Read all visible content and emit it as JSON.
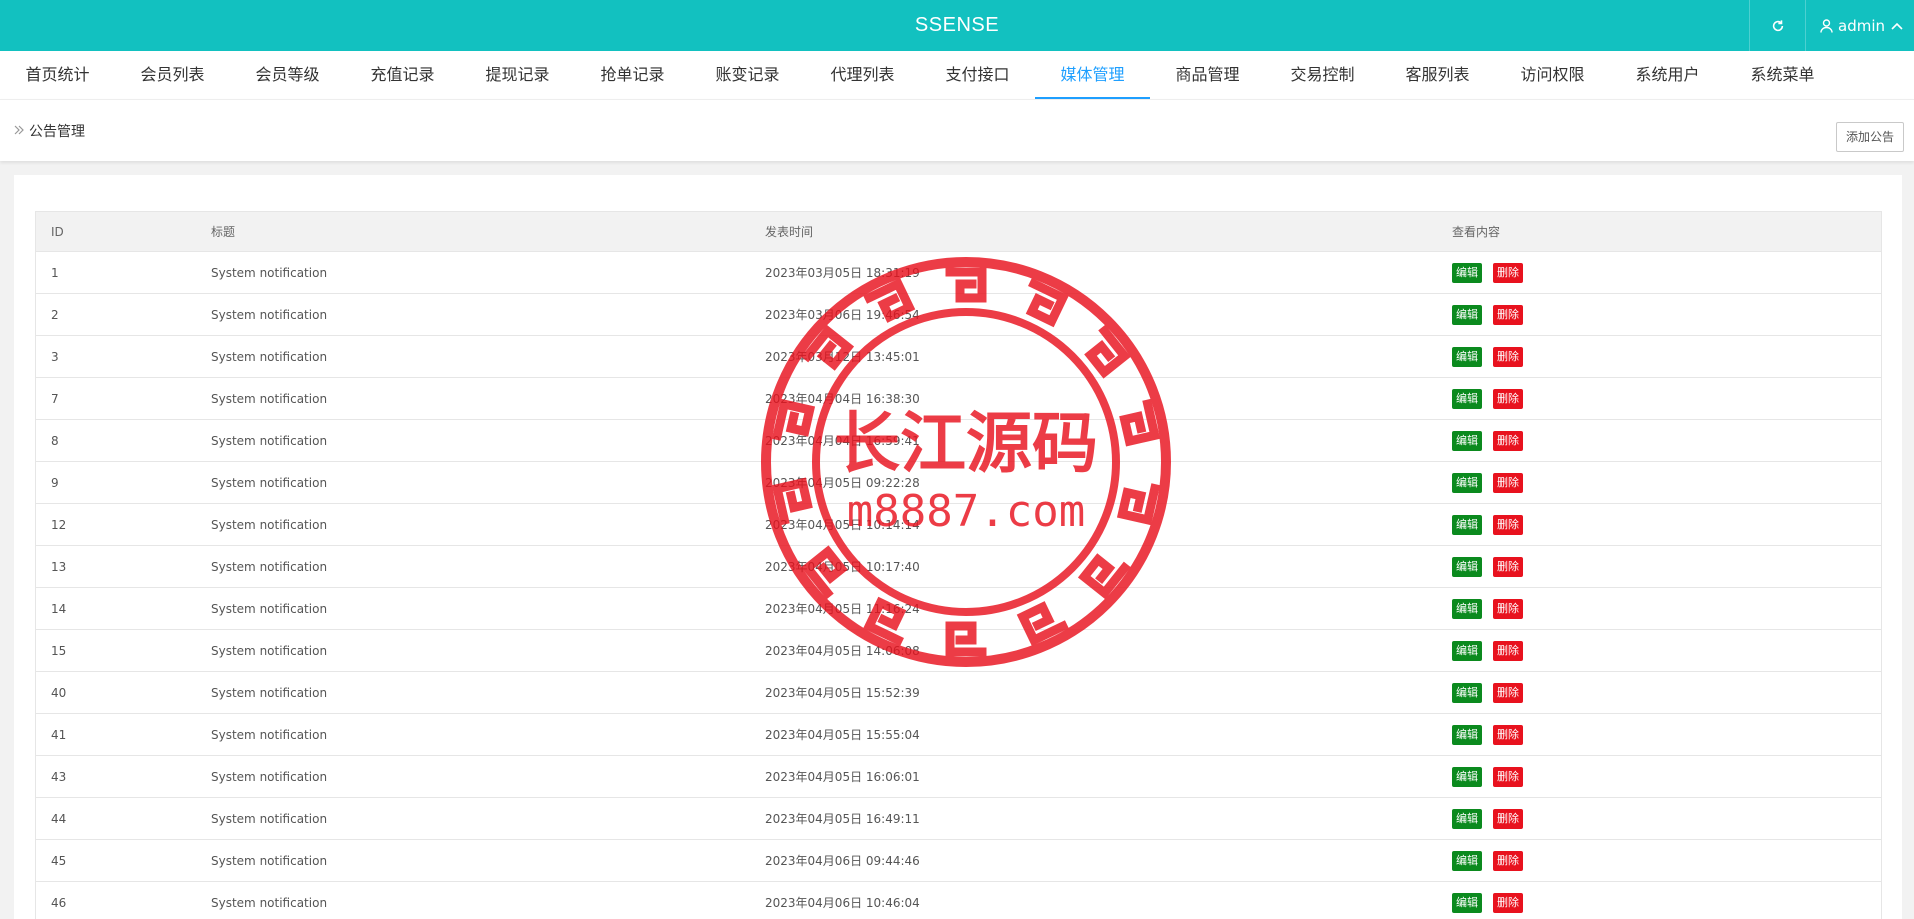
{
  "app": {
    "brand": "SSENSE",
    "user": "admin"
  },
  "nav": [
    {
      "label": "首页统计"
    },
    {
      "label": "会员列表"
    },
    {
      "label": "会员等级"
    },
    {
      "label": "充值记录"
    },
    {
      "label": "提现记录"
    },
    {
      "label": "抢单记录"
    },
    {
      "label": "账变记录"
    },
    {
      "label": "代理列表"
    },
    {
      "label": "支付接口"
    },
    {
      "label": "媒体管理",
      "active": true
    },
    {
      "label": "商品管理"
    },
    {
      "label": "交易控制"
    },
    {
      "label": "客服列表"
    },
    {
      "label": "访问权限"
    },
    {
      "label": "系统用户"
    },
    {
      "label": "系统菜单"
    }
  ],
  "breadcrumb": {
    "icon": "double-chevron-right-icon",
    "label": "公告管理"
  },
  "toolbar": {
    "add_label": "添加公告"
  },
  "table": {
    "headers": {
      "id": "ID",
      "title": "标题",
      "time": "发表时间",
      "actions": "查看内容"
    },
    "edit_label": "编辑",
    "delete_label": "删除",
    "rows": [
      {
        "id": "1",
        "title": "System notification",
        "time": "2023年03月05日 18:31:19"
      },
      {
        "id": "2",
        "title": "System notification",
        "time": "2023年03月06日 19:46:54"
      },
      {
        "id": "3",
        "title": "System notification",
        "time": "2023年03月12日 13:45:01"
      },
      {
        "id": "7",
        "title": "System notification",
        "time": "2023年04月04日 16:38:30"
      },
      {
        "id": "8",
        "title": "System notification",
        "time": "2023年04月04日 16:59:41"
      },
      {
        "id": "9",
        "title": "System notification",
        "time": "2023年04月05日 09:22:28"
      },
      {
        "id": "12",
        "title": "System notification",
        "time": "2023年04月05日 10:14:14"
      },
      {
        "id": "13",
        "title": "System notification",
        "time": "2023年04月05日 10:17:40"
      },
      {
        "id": "14",
        "title": "System notification",
        "time": "2023年04月05日 11:16:24"
      },
      {
        "id": "15",
        "title": "System notification",
        "time": "2023年04月05日 14:06:08"
      },
      {
        "id": "40",
        "title": "System notification",
        "time": "2023年04月05日 15:52:39"
      },
      {
        "id": "41",
        "title": "System notification",
        "time": "2023年04月05日 15:55:04"
      },
      {
        "id": "43",
        "title": "System notification",
        "time": "2023年04月05日 16:06:01"
      },
      {
        "id": "44",
        "title": "System notification",
        "time": "2023年04月05日 16:49:11"
      },
      {
        "id": "45",
        "title": "System notification",
        "time": "2023年04月06日 09:44:46"
      },
      {
        "id": "46",
        "title": "System notification",
        "time": "2023年04月06日 10:46:04"
      }
    ]
  },
  "watermark": {
    "line1": "长江源码",
    "line2": "m8887.com",
    "color": "#e8121e"
  },
  "colors": {
    "topbar": "#12c1c0",
    "active_nav": "#1e9fff",
    "edit": "#0b8a1e",
    "delete": "#e8121e"
  }
}
